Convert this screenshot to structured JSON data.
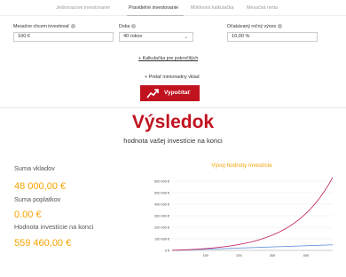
{
  "tabs": [
    {
      "label": "Jednorazové investovanie",
      "active": false
    },
    {
      "label": "Pravidelné investovanie",
      "active": true
    },
    {
      "label": "Miliónová kalkulačka",
      "active": false
    },
    {
      "label": "Mesačná renta",
      "active": false
    }
  ],
  "form": {
    "monthly_label": "Mesačne chcem investovať",
    "monthly_value": "100 €",
    "period_label": "Doba",
    "period_value": "40 rokov",
    "yield_label": "Očakávaný ročný výnos",
    "yield_value": "10,00 %"
  },
  "advanced_link": "+ Kalkulačka pre pokročilých",
  "extra_deposit": "+ Pridať mimoriadny vklad",
  "calculate_button": "Vypočítať",
  "result": {
    "title": "Výsledok",
    "subtitle": "hodnota vašej investície na konci",
    "deposits_label": "Suma vkladov",
    "deposits_value": "48 000,00 €",
    "fees_label": "Suma poplatkov",
    "fees_value": "0.00 €",
    "final_label": "Hodnota investície na konci",
    "final_value": "559 460,00 €"
  },
  "colors": {
    "brand_red": "#c1121f",
    "accent_orange": "#f5a300",
    "investment_line": "#c2185b",
    "deposit_line": "#5b8fd6"
  },
  "chart_data": {
    "type": "line",
    "title": "Vývoj hodnoty investície",
    "x_ticks": [
      "100",
      "200",
      "300",
      "400"
    ],
    "y_ticks": [
      "0 €",
      "100 000 €",
      "200 000 €",
      "300 000 €",
      "400 000 €",
      "500 000 €",
      "600 000 €"
    ],
    "xlim": [
      0,
      480
    ],
    "ylim": [
      0,
      600000
    ],
    "monthly_deposit": 100,
    "annual_rate": 0.1,
    "months": 480,
    "series": [
      {
        "key": "value",
        "color": "#c2185b"
      },
      {
        "key": "deposits",
        "color": "#5b8fd6"
      }
    ]
  }
}
